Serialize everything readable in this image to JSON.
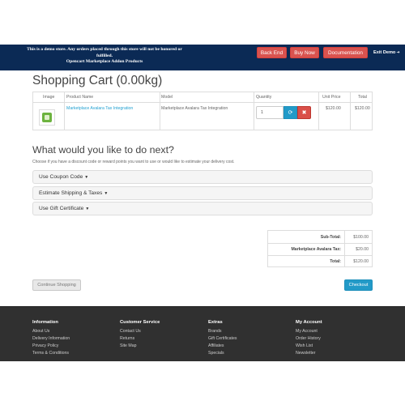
{
  "demo_banner": {
    "message_line1": "This is a demo store. Any orders placed through this store will not be honored or",
    "message_line2": "fulfilled.",
    "message_line3": "Opencart Marketplace Addon Products",
    "back_end_label": "Back End",
    "buy_now_label": "Buy Now",
    "documentation_label": "Documentation",
    "exit_demo_label": "Exit Demo",
    "exit_demo_icon": "arrow-right-icon"
  },
  "page": {
    "title": "Shopping Cart  (0.00kg)"
  },
  "cart_table": {
    "headers": {
      "image": "Image",
      "product_name": "Product Name",
      "model": "Model",
      "quantity": "Quantity",
      "unit_price": "Unit Price",
      "total": "Total"
    },
    "rows": [
      {
        "product_name": "Marketplace Avalara Tax Integration",
        "model": "Marketplace Avalara Tax Integration",
        "quantity": "1",
        "unit_price": "$120.00",
        "total": "$120.00",
        "update_icon": "refresh-icon",
        "remove_icon": "close-circle-icon"
      }
    ]
  },
  "next_section": {
    "title": "What would you like to do next?",
    "description": "Choose if you have a discount code or reward points you want to use or would like to estimate your delivery cost.",
    "panels": [
      {
        "label": "Use Coupon Code",
        "icon": "caret-down-icon"
      },
      {
        "label": "Estimate Shipping & Taxes",
        "icon": "caret-down-icon"
      },
      {
        "label": "Use Gift Certificate",
        "icon": "caret-down-icon"
      }
    ]
  },
  "totals": [
    {
      "label": "Sub-Total:",
      "value": "$100.00"
    },
    {
      "label": "Marketplace Avalara Tax:",
      "value": "$20.00"
    },
    {
      "label": "Total:",
      "value": "$120.00"
    }
  ],
  "actions": {
    "continue_label": "Continue Shopping",
    "checkout_label": "Checkout"
  },
  "footer": {
    "columns": [
      {
        "heading": "Information",
        "links": [
          "About Us",
          "Delivery Information",
          "Privacy Policy",
          "Terms & Conditions"
        ]
      },
      {
        "heading": "Customer Service",
        "links": [
          "Contact Us",
          "Returns",
          "Site Map"
        ]
      },
      {
        "heading": "Extras",
        "links": [
          "Brands",
          "Gift Certificates",
          "Affiliates",
          "Specials"
        ]
      },
      {
        "heading": "My Account",
        "links": [
          "My Account",
          "Order History",
          "Wish List",
          "Newsletter"
        ]
      }
    ]
  },
  "colors": {
    "banner_bg": "#0b2a55",
    "danger": "#d9534f",
    "primary": "#229ac8",
    "link": "#23a1d1",
    "footer_bg": "#303030"
  }
}
